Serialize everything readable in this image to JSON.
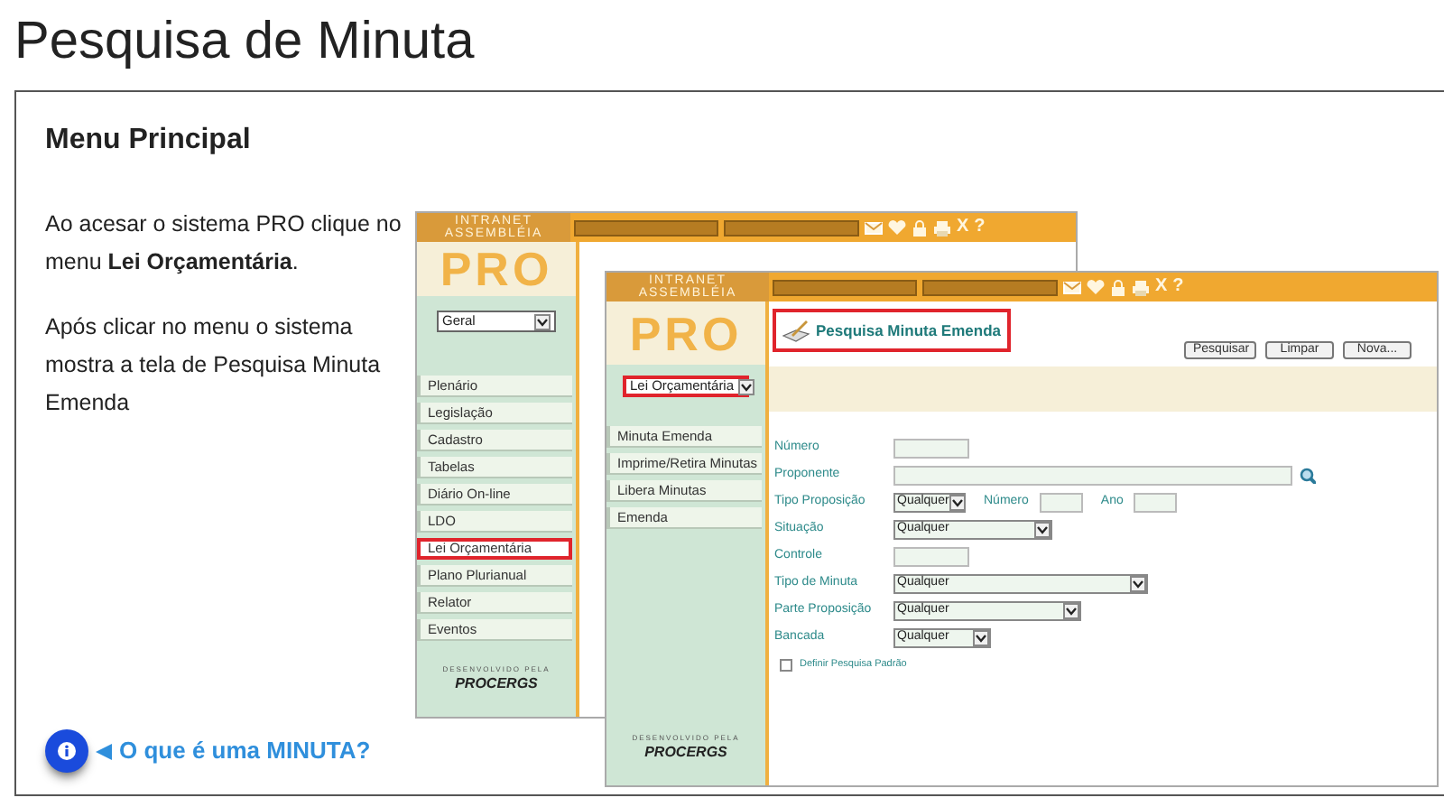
{
  "page_title": "Pesquisa de Minuta",
  "section_heading": "Menu Principal",
  "paragraphs": [
    "Ao acesar o sistema PRO clique no menu **Lei Orçamentária**.",
    "Após clicar no menu o sistema mostra a tela de Pesquisa Minuta Emenda"
  ],
  "screenshots": [
    {
      "brand": [
        "INTRANET",
        "ASSEMBLÉIA"
      ],
      "logo": "PRO",
      "toolbar_glyphs": [
        "X",
        "?"
      ],
      "menu_select": {
        "value": "Geral",
        "highlighted": false
      },
      "menu_items": [
        {
          "label": "Plenário",
          "highlighted": false
        },
        {
          "label": "Legislação",
          "highlighted": false
        },
        {
          "label": "Cadastro",
          "highlighted": false
        },
        {
          "label": "Tabelas",
          "highlighted": false
        },
        {
          "label": "Diário On-line",
          "highlighted": false
        },
        {
          "label": "LDO",
          "highlighted": false
        },
        {
          "label": "Lei Orçamentária",
          "highlighted": true
        },
        {
          "label": "Plano Plurianual",
          "highlighted": false
        },
        {
          "label": "Relator",
          "highlighted": false
        },
        {
          "label": "Eventos",
          "highlighted": false
        }
      ],
      "footer": [
        "DESENVOLVIDO PELA",
        "PROCERGS"
      ]
    },
    {
      "brand": [
        "INTRANET",
        "ASSEMBLÉIA"
      ],
      "logo": "PRO",
      "toolbar_glyphs": [
        "X",
        "?"
      ],
      "menu_select": {
        "value": "Lei Orçamentária",
        "highlighted": true
      },
      "menu_items": [
        {
          "label": "Minuta Emenda",
          "highlighted": false
        },
        {
          "label": "Imprime/Retira Minutas",
          "highlighted": false
        },
        {
          "label": "Libera Minutas",
          "highlighted": false
        },
        {
          "label": "Emenda",
          "highlighted": false
        }
      ],
      "footer": [
        "DESENVOLVIDO PELA",
        "PROCERGS"
      ],
      "form": {
        "title": "Pesquisa Minuta Emenda",
        "title_highlighted": true,
        "buttons": [
          "Pesquisar",
          "Limpar",
          "Nova..."
        ],
        "fields": [
          {
            "label": "Número",
            "kind": "text"
          },
          {
            "label": "Proponente",
            "kind": "lookup"
          },
          {
            "label": "Tipo Proposição",
            "kind": "select",
            "value": "Qualquer",
            "extras": [
              "Número",
              "Ano"
            ]
          },
          {
            "label": "Situação",
            "kind": "select",
            "value": "Qualquer"
          },
          {
            "label": "Controle",
            "kind": "text"
          },
          {
            "label": "Tipo de Minuta",
            "kind": "select",
            "value": "Qualquer"
          },
          {
            "label": "Parte Proposição",
            "kind": "select",
            "value": "Qualquer"
          },
          {
            "label": "Bancada",
            "kind": "select",
            "value": "Qualquer"
          }
        ],
        "checkbox": {
          "label": "Definir Pesquisa Padrão",
          "checked": false
        }
      }
    }
  ],
  "help_link": "O que é uma MINUTA?"
}
